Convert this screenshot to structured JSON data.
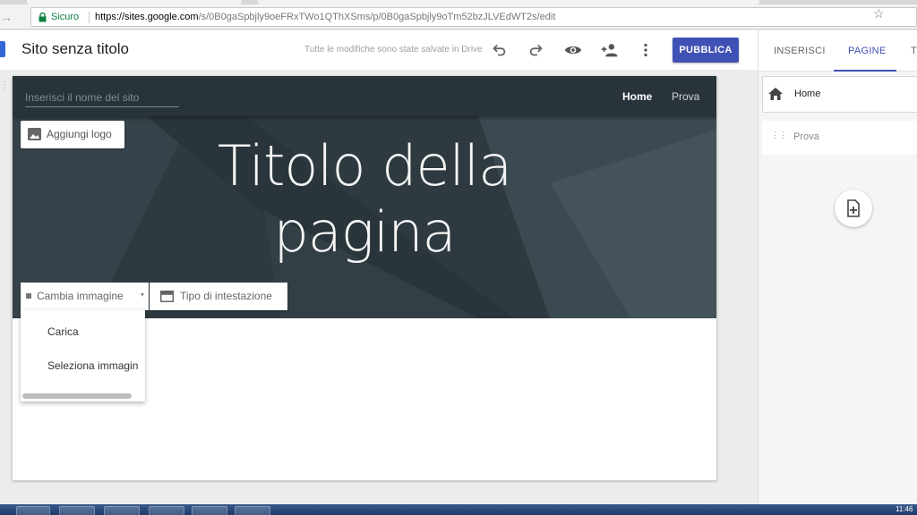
{
  "browser": {
    "secure_label": "Sicuro",
    "url_host": "https://sites.google.com",
    "url_path": "/s/0B0gaSpbjly9oeFRxTWo1QThXSms/p/0B0gaSpbjly9oTm52bzJLVEdWT2s/edit"
  },
  "header": {
    "site_title": "Sito senza titolo",
    "saved_status": "Tutte le modifiche sono state salvate in Drive",
    "publish_label": "PUBBLICA"
  },
  "hero": {
    "site_name_placeholder": "Inserisci il nome del sito",
    "nav_items": [
      "Home",
      "Prova"
    ],
    "add_logo_label": "Aggiungi logo",
    "title_line1": "Titolo della",
    "title_line2": "pagina",
    "change_image_label": "Cambia immagine",
    "header_type_label": "Tipo di intestazione"
  },
  "image_menu": {
    "items": [
      "Carica",
      "Seleziona immagin"
    ]
  },
  "side_panel": {
    "tabs": [
      "INSERISCI",
      "PAGINE",
      "T"
    ],
    "active_tab": "PAGINE",
    "pages": [
      "Home",
      "Prova"
    ]
  },
  "taskbar": {
    "clock": "11:46"
  },
  "colors": {
    "accent": "#3f51b5",
    "hero_bg": "#2f3c42",
    "secure_green": "#0b8043"
  }
}
